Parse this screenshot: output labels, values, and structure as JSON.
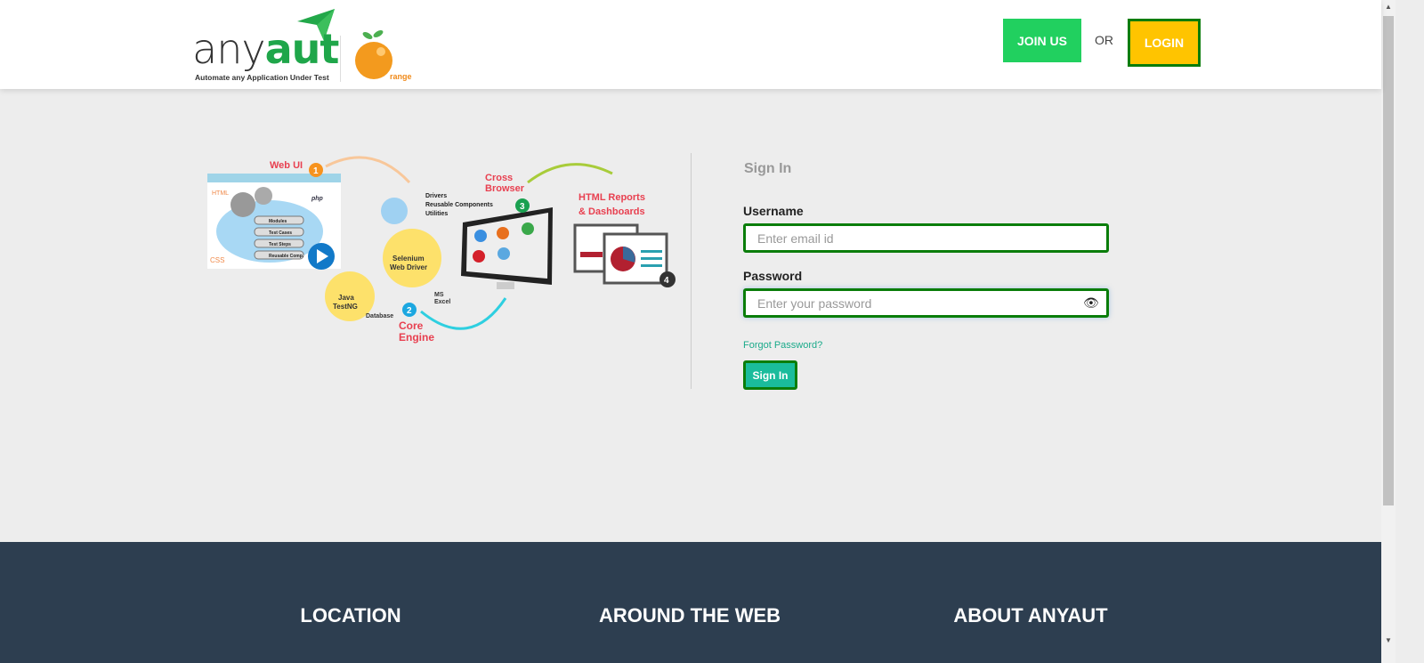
{
  "header": {
    "logo_any": "any",
    "logo_aut": "aut",
    "logo_tagline": "Automate any Application Under Test",
    "partner": "range",
    "join_label": "JOIN US",
    "or_label": "OR",
    "login_label": "LOGIN"
  },
  "illustration": {
    "web_ui": "Web UI",
    "html": "HTML",
    "css": "CSS",
    "php": "php",
    "modules": "Modules",
    "test_cases": "Test Cases",
    "test_steps": "Test Steps",
    "reusable": "Reusable Comp.",
    "drivers": "Drivers",
    "reusable_components": "Reusable Components",
    "utilities": "Utilities",
    "selenium": "Selenium",
    "web_driver": "Web Driver",
    "java": "Java",
    "testng": "TestNG",
    "database": "Database",
    "ms": "MS",
    "excel": "Excel",
    "core": "Core",
    "engine": "Engine",
    "cross": "Cross",
    "browser": "Browser",
    "reports": "HTML Reports",
    "dashboards": "& Dashboards",
    "n1": "1",
    "n2": "2",
    "n3": "3",
    "n4": "4"
  },
  "form": {
    "title": "Sign In",
    "username_label": "Username",
    "username_placeholder": "Enter email id",
    "password_label": "Password",
    "password_placeholder": "Enter your password",
    "forgot": "Forgot Password?",
    "submit": "Sign In"
  },
  "footer": {
    "location": "LOCATION",
    "around": "AROUND THE WEB",
    "about": "ABOUT ANYAUT"
  }
}
